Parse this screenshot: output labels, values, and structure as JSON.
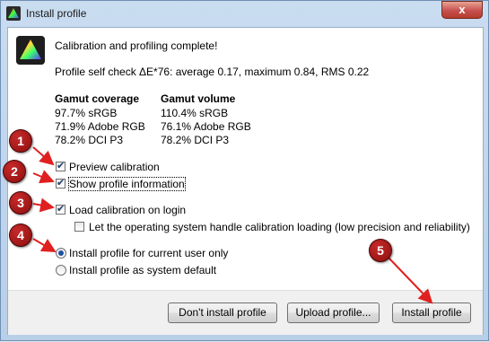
{
  "window": {
    "title": "Install profile",
    "close_label": "x"
  },
  "summary": {
    "heading": "Calibration and profiling complete!",
    "self_check": "Profile self check ΔE*76: average 0.17, maximum 0.84, RMS 0.22"
  },
  "gamut": {
    "coverage_header": "Gamut coverage",
    "coverage": [
      "97.7% sRGB",
      "71.9% Adobe RGB",
      "78.2% DCI P3"
    ],
    "volume_header": "Gamut volume",
    "volume": [
      "110.4% sRGB",
      "76.1% Adobe RGB",
      "78.2% DCI P3"
    ]
  },
  "options": {
    "preview_calibration": "Preview calibration",
    "show_profile_information": "Show profile information",
    "load_calibration": "Load calibration on login",
    "os_handle_loading": "Let the operating system handle calibration loading (low precision and reliability)",
    "install_current_user": "Install profile for current user only",
    "install_system_default": "Install profile as system default"
  },
  "buttons": {
    "dont_install": "Don't install profile",
    "upload": "Upload profile...",
    "install": "Install profile"
  },
  "markers": [
    "1",
    "2",
    "3",
    "4",
    "5"
  ],
  "colors": {
    "marker_red": "#a01212",
    "arrow_red": "#e02020"
  }
}
